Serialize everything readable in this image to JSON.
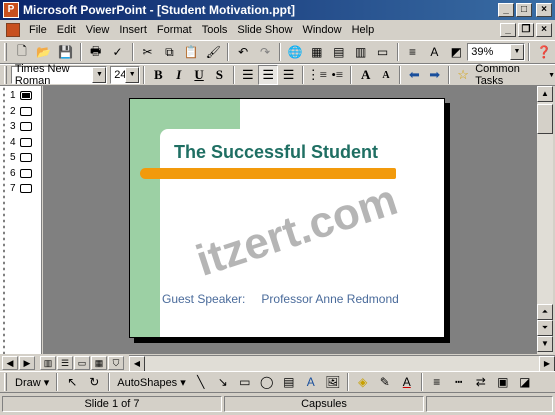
{
  "window": {
    "title": "Microsoft PowerPoint - [Student Motivation.ppt]",
    "app_icon": "P",
    "buttons": [
      "_",
      "□",
      "×"
    ]
  },
  "menu": [
    "File",
    "Edit",
    "View",
    "Insert",
    "Format",
    "Tools",
    "Slide Show",
    "Window",
    "Help"
  ],
  "doc_buttons": [
    "_",
    "❐",
    "×"
  ],
  "standard_toolbar": {
    "zoom": "39%"
  },
  "formatting_toolbar": {
    "font": "Times New Roman",
    "size": "24",
    "common_tasks": "Common Tasks"
  },
  "outline": {
    "slides": [
      "1",
      "2",
      "3",
      "4",
      "5",
      "6",
      "7"
    ],
    "selected": 1
  },
  "slide": {
    "title": "The Successful Student",
    "subtitle_label": "Guest Speaker:",
    "subtitle_name": "Professor Anne Redmond",
    "colors": {
      "band": "#9cd0a4",
      "bar": "#f29a0c",
      "title": "#1f6f63",
      "subtitle": "#4a6b9b"
    }
  },
  "watermark": "itzert.com",
  "drawing_toolbar": {
    "draw": "Draw",
    "autoshapes": "AutoShapes"
  },
  "status": {
    "slide": "Slide 1 of 7",
    "design": "Capsules"
  }
}
